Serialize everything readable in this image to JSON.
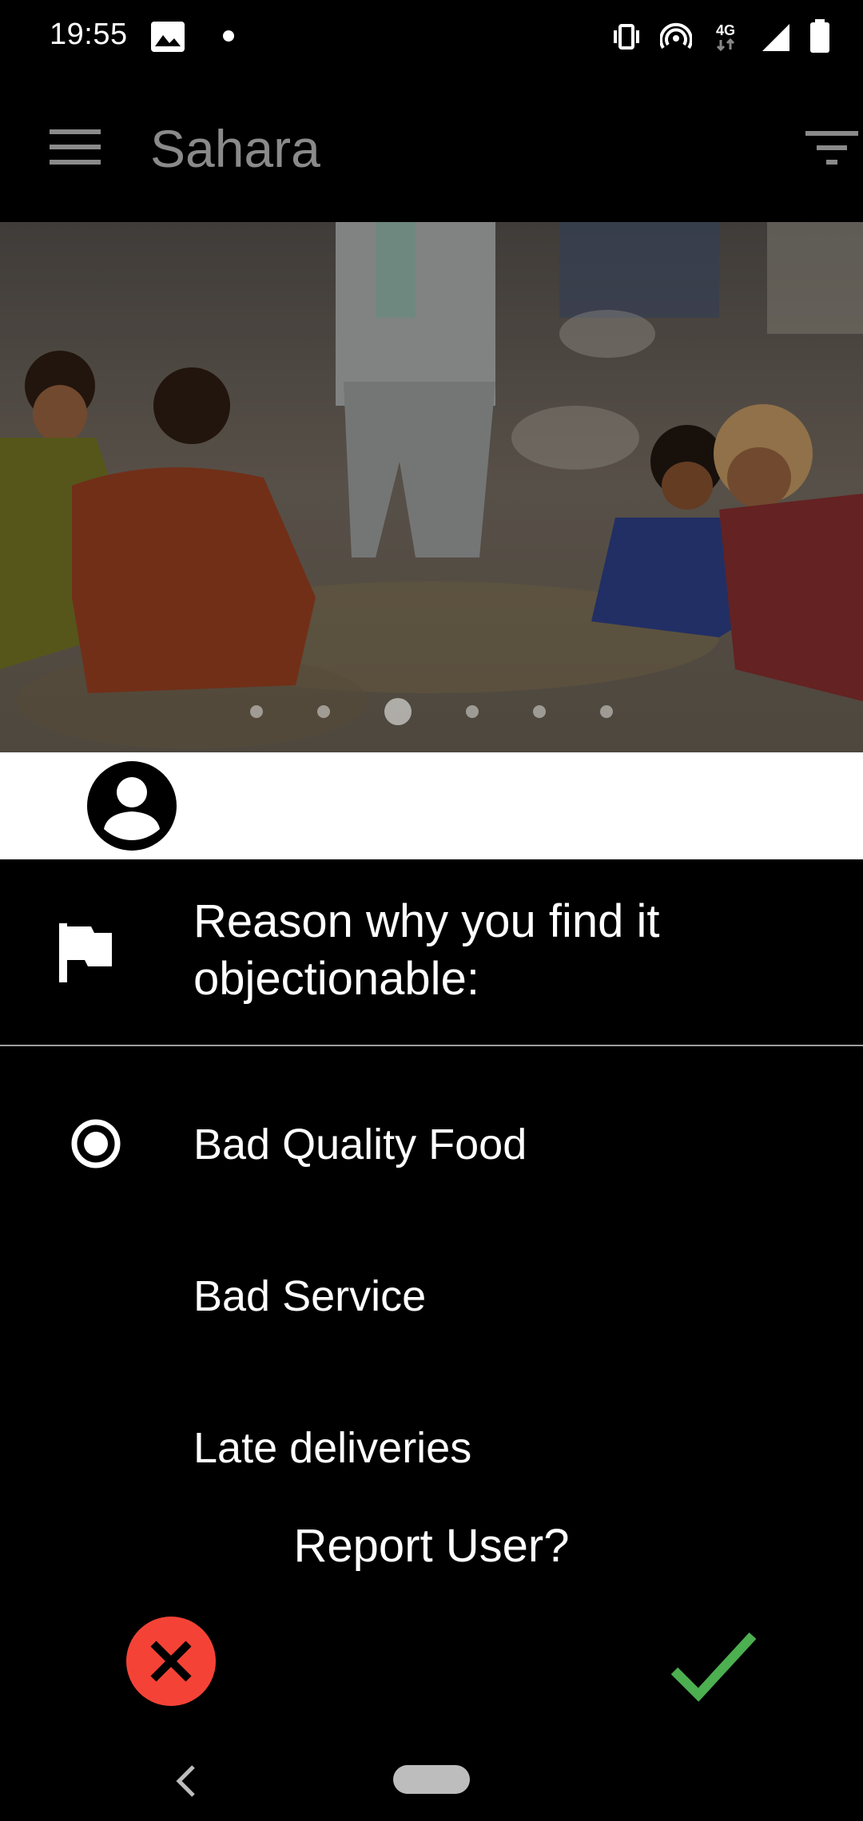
{
  "status_bar": {
    "time": "19:55",
    "icons": [
      "image-icon",
      "notification-dot",
      "vibrate-icon",
      "hotspot-icon",
      "4g-icon",
      "signal-icon",
      "battery-icon"
    ],
    "network_label": "4G"
  },
  "app_bar": {
    "title": "Sahara",
    "menu_icon": "menu-icon",
    "filter_icon": "filter-icon"
  },
  "carousel": {
    "page_count": 6,
    "active_index": 2
  },
  "dialog": {
    "title": "Reason why you find it objectionable:",
    "options": [
      {
        "label": "Bad Quality Food",
        "selected": true
      },
      {
        "label": "Bad Service",
        "selected": false
      },
      {
        "label": "Late deliveries",
        "selected": false
      }
    ],
    "question": "Report User?",
    "cancel_icon": "close-icon",
    "confirm_icon": "check-icon"
  },
  "colors": {
    "cancel": "#f44336",
    "confirm": "#4caf50",
    "app_title": "#8a8a8a"
  }
}
